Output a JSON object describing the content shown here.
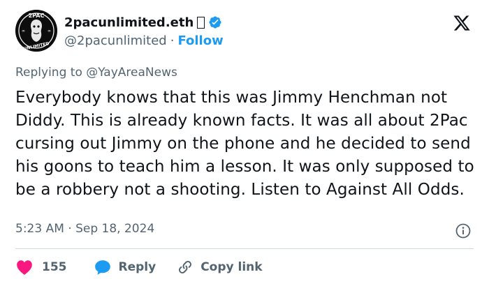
{
  "author": {
    "display_name": "2pacunlimited.eth",
    "handle": "@2pacunlimited",
    "follow_label": "Follow",
    "separator": "·",
    "avatar_text_top": "2PAC",
    "avatar_text_bottom": "UNLIMITED"
  },
  "reply_context": {
    "prefix": "Replying to",
    "mention": "@YayAreaNews"
  },
  "tweet": {
    "text": "Everybody knows that this was Jimmy Henchman not Diddy. This is already known facts. It was all about 2Pac cursing out Jimmy on the phone and he decided to send his goons to teach him a lesson. It was only supposed to be a robbery not a shooting. Listen to Against All Odds.",
    "time": "5:23 AM",
    "separator": "·",
    "date": "Sep 18, 2024"
  },
  "actions": {
    "like_count": "155",
    "reply_label": "Reply",
    "copy_label": "Copy link"
  },
  "colors": {
    "accent": "#1d9bf0",
    "like": "#f91880",
    "text": "#0f1419",
    "muted": "#536471"
  }
}
